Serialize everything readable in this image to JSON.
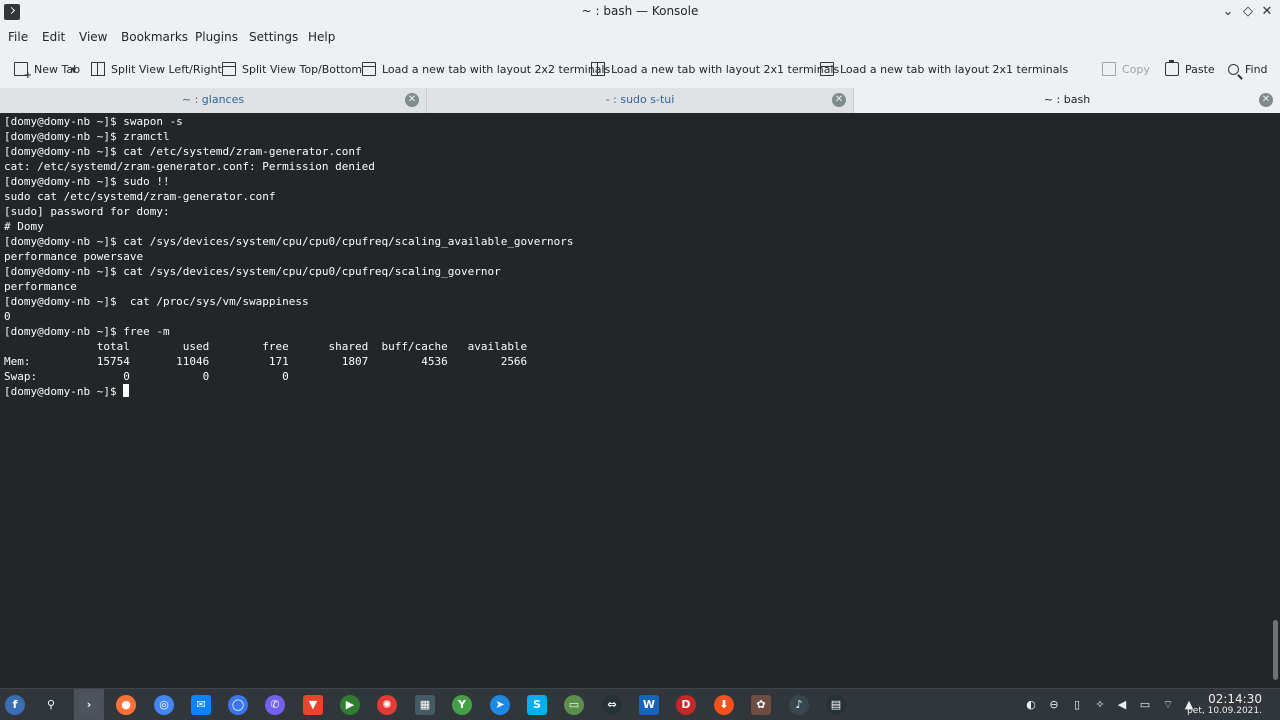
{
  "window": {
    "title": "~ : bash — Konsole",
    "minimize_icon": "chevron-down-icon",
    "maximize_icon": "diamond-icon",
    "close_icon": "close-icon"
  },
  "menu": {
    "items": [
      "File",
      "Edit",
      "View",
      "Bookmarks",
      "Plugins",
      "Settings",
      "Help"
    ]
  },
  "toolbar": {
    "new_tab": "New Tab",
    "split_left_right": "Split View Left/Right",
    "split_top_bottom": "Split View Top/Bottom",
    "layout_2x2": "Load a new tab with layout 2x2 terminals",
    "layout_2x1_a": "Load a new tab with layout 2x1 terminals",
    "layout_2x1_b": "Load a new tab with layout 2x1 terminals",
    "copy": "Copy",
    "paste": "Paste",
    "find": "Find"
  },
  "tabs": [
    {
      "label": "~ : glances",
      "active": false
    },
    {
      "label": "- : sudo s-tui",
      "active": false
    },
    {
      "label": "~ : bash",
      "active": true
    }
  ],
  "terminal": {
    "lines": [
      "[domy@domy-nb ~]$ swapon -s",
      "[domy@domy-nb ~]$ zramctl",
      "[domy@domy-nb ~]$ cat /etc/systemd/zram-generator.conf",
      "cat: /etc/systemd/zram-generator.conf: Permission denied",
      "[domy@domy-nb ~]$ sudo !!",
      "sudo cat /etc/systemd/zram-generator.conf",
      "[sudo] password for domy:",
      "# Domy",
      "[domy@domy-nb ~]$ cat /sys/devices/system/cpu/cpu0/cpufreq/scaling_available_governors",
      "performance powersave",
      "[domy@domy-nb ~]$ cat /sys/devices/system/cpu/cpu0/cpufreq/scaling_governor",
      "performance",
      "[domy@domy-nb ~]$  cat /proc/sys/vm/swappiness",
      "0",
      "[domy@domy-nb ~]$ free -m",
      "              total        used        free      shared  buff/cache   available",
      "Mem:          15754       11046         171        1807        4536        2566",
      "Swap:             0           0           0"
    ],
    "prompt": "[domy@domy-nb ~]$ "
  },
  "taskbar": {
    "icons": [
      {
        "name": "fedora-launcher-icon",
        "color": "#3c6eb4",
        "glyph": "f"
      },
      {
        "name": "search-icon",
        "color": "#31363b",
        "glyph": "⚲"
      },
      {
        "name": "konsole-icon",
        "color": "#4d545b",
        "glyph": "›"
      },
      {
        "name": "firefox-icon",
        "color": "#ff7139",
        "glyph": "●"
      },
      {
        "name": "chrome-icon",
        "color": "#4285f4",
        "glyph": "◎"
      },
      {
        "name": "thunderbird-icon",
        "color": "#0a84ff",
        "glyph": "✉"
      },
      {
        "name": "signal-icon",
        "color": "#3a76f0",
        "glyph": "◯"
      },
      {
        "name": "viber-icon",
        "color": "#7360f2",
        "glyph": "✆"
      },
      {
        "name": "downloader-icon",
        "color": "#e8452c",
        "glyph": "▼"
      },
      {
        "name": "player-icon",
        "color": "#2e7d32",
        "glyph": "▶"
      },
      {
        "name": "mascot-icon",
        "color": "#e53935",
        "glyph": "✺"
      },
      {
        "name": "calculator-icon",
        "color": "#455a64",
        "glyph": "▦"
      },
      {
        "name": "y-app-icon",
        "color": "#43a047",
        "glyph": "Y"
      },
      {
        "name": "browser-icon",
        "color": "#1e88e5",
        "glyph": "➤"
      },
      {
        "name": "skype-icon",
        "color": "#00aff0",
        "glyph": "S"
      },
      {
        "name": "remote-desktop-icon",
        "color": "#5a8f4e",
        "glyph": "▭"
      },
      {
        "name": "sync-icon",
        "color": "#263238",
        "glyph": "⇔"
      },
      {
        "name": "writer-icon",
        "color": "#1565c0",
        "glyph": "W"
      },
      {
        "name": "doublecmd-icon",
        "color": "#c62828",
        "glyph": "D"
      },
      {
        "name": "downloads-icon",
        "color": "#f4511e",
        "glyph": "⬇"
      },
      {
        "name": "clipboard-app-icon",
        "color": "#6d4c41",
        "glyph": "✿"
      },
      {
        "name": "volume-mixer-icon",
        "color": "#37474f",
        "glyph": "♪"
      },
      {
        "name": "clapper-icon",
        "color": "#263238",
        "glyph": "▤"
      }
    ],
    "tray": [
      {
        "name": "update-icon",
        "glyph": "◐"
      },
      {
        "name": "no-entry-icon",
        "glyph": "⊖"
      },
      {
        "name": "clipboard-icon",
        "glyph": "▯"
      },
      {
        "name": "bulb-icon",
        "glyph": "✧"
      },
      {
        "name": "volume-icon",
        "glyph": "◀"
      },
      {
        "name": "battery-icon",
        "glyph": "▭"
      },
      {
        "name": "wifi-icon",
        "glyph": "⌔"
      },
      {
        "name": "tray-expand-icon",
        "glyph": "▲"
      }
    ],
    "clock_time": "02:14:30",
    "clock_date": "pet, 10.09.2021."
  }
}
